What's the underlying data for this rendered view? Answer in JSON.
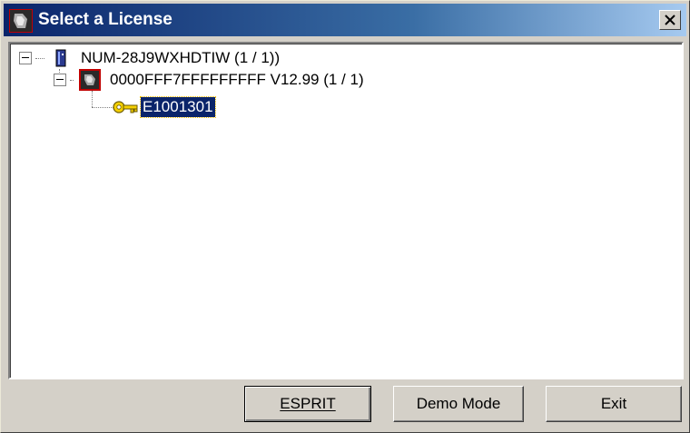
{
  "window": {
    "title": "Select a License",
    "close_glyph": "✕"
  },
  "tree": {
    "root": {
      "label": "NUM-28J9WXHDTIW (1 / 1))",
      "icon": "server-icon",
      "expanded": true
    },
    "child": {
      "label": "0000FFF7FFFFFFFFF V12.99 (1 / 1)",
      "icon": "esprit-app-icon",
      "expanded": true
    },
    "leaf": {
      "label": "E1001301",
      "icon": "key-icon",
      "selected": true
    }
  },
  "buttons": {
    "esprit": "ESPRIT",
    "demo_mode": "Demo Mode",
    "exit": "Exit"
  },
  "colors": {
    "title_bar": "#0a246a",
    "selection": "#0a246a",
    "key": "#f5d000"
  }
}
